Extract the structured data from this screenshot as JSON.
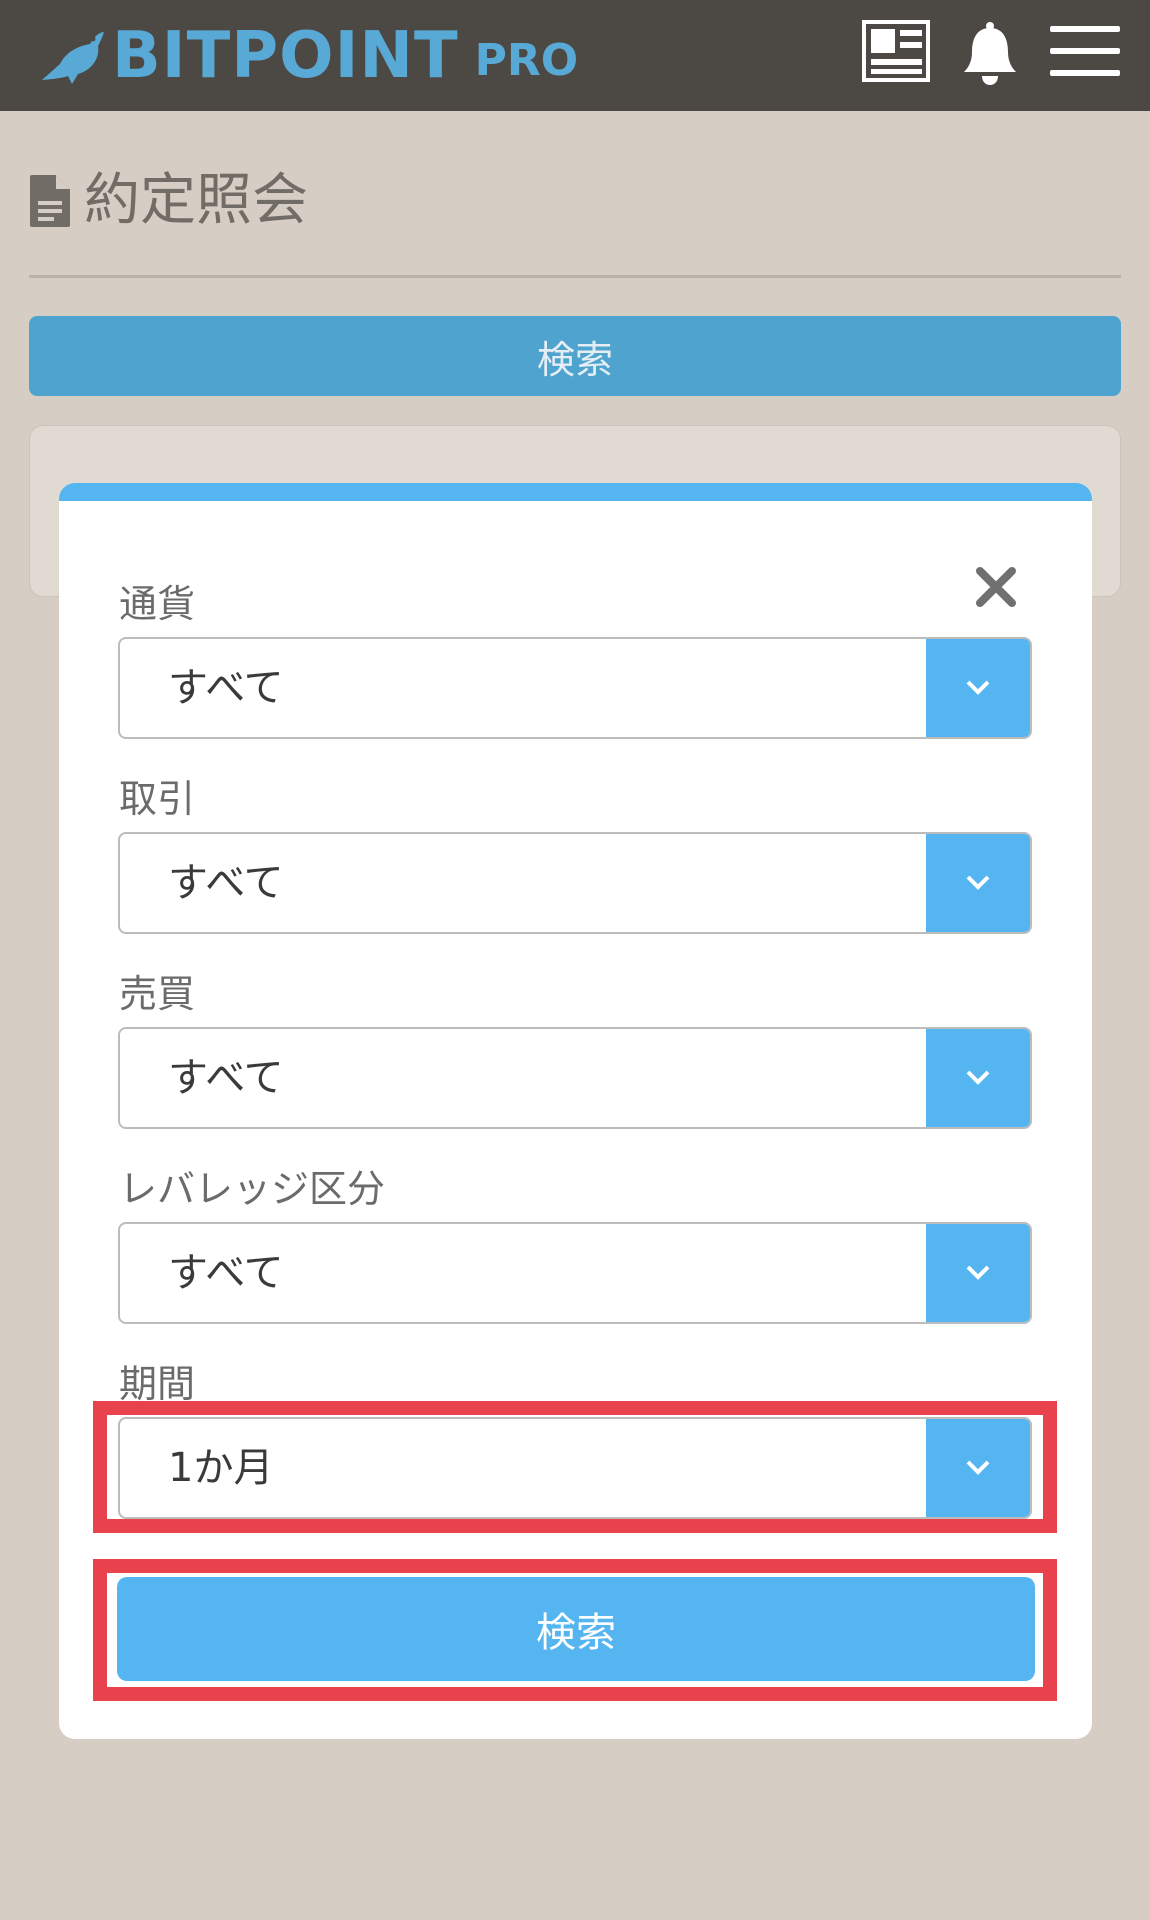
{
  "header": {
    "logo_text": "BITPOINT",
    "logo_suffix": "PRO",
    "icons": [
      "bird-logo-icon",
      "news-icon",
      "bell-icon",
      "menu-icon"
    ]
  },
  "page": {
    "title": "約定照会",
    "title_icon": "document-icon",
    "search_button": "検索"
  },
  "modal": {
    "close_icon": "close-icon",
    "fields": [
      {
        "label": "通貨",
        "value": "すべて"
      },
      {
        "label": "取引",
        "value": "すべて"
      },
      {
        "label": "売買",
        "value": "すべて"
      },
      {
        "label": "レバレッジ区分",
        "value": "すべて"
      },
      {
        "label": "期間",
        "value": "1か月"
      }
    ],
    "search_button": "検索"
  },
  "colors": {
    "header_bg": "#4c4844",
    "brand_blue": "#59a9d6",
    "accent": "#54b5f1",
    "highlight": "#e8424c",
    "page_bg": "#d6cec5"
  }
}
